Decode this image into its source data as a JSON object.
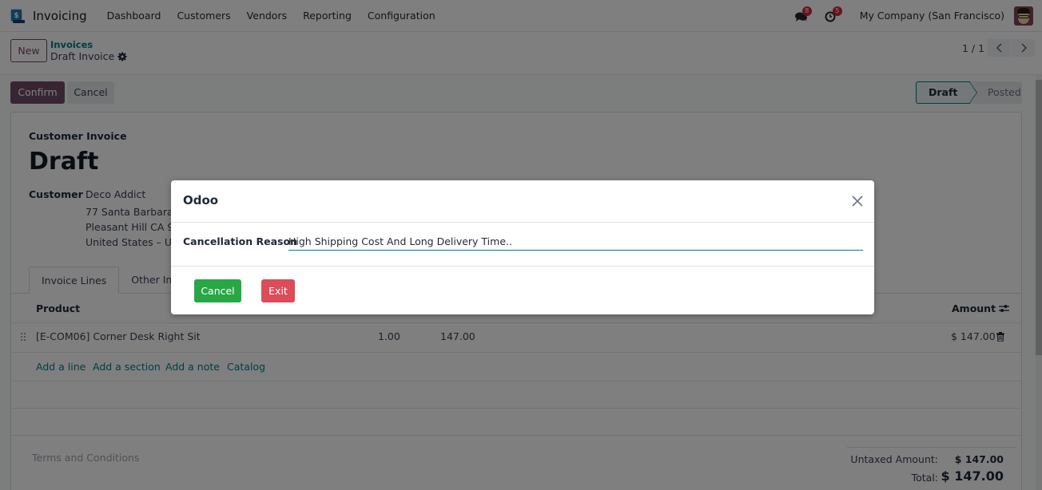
{
  "navbar": {
    "app_name": "Invoicing",
    "menu": [
      "Dashboard",
      "Customers",
      "Vendors",
      "Reporting",
      "Configuration"
    ],
    "messages_count": "8",
    "activities_count": "5",
    "company": "My Company (San Francisco)"
  },
  "control_panel": {
    "new_label": "New",
    "breadcrumb_parent": "Invoices",
    "breadcrumb_current": "Draft Invoice",
    "pager": "1 / 1"
  },
  "statusbar": {
    "confirm_label": "Confirm",
    "cancel_label": "Cancel",
    "stages": [
      "Draft",
      "Posted"
    ],
    "active_stage": "Draft"
  },
  "form": {
    "type": "Customer Invoice",
    "title": "Draft",
    "customer_label": "Customer",
    "customer_lines": [
      "Deco Addict",
      "77 Santa Barbara R",
      "Pleasant Hill CA 94",
      "United States – US"
    ],
    "tabs": [
      "Invoice Lines",
      "Other Info"
    ],
    "columns": {
      "product": "Product",
      "amount": "Amount"
    },
    "lines": [
      {
        "product": "[E-COM06] Corner Desk Right Sit",
        "quantity": "1.00",
        "price": "147.00",
        "amount": "$ 147.00"
      }
    ],
    "add_links": [
      "Add a line",
      "Add a section",
      "Add a note",
      "Catalog"
    ],
    "terms_placeholder": "Terms and Conditions",
    "totals": {
      "untaxed_label": "Untaxed Amount:",
      "untaxed_value": "$ 147.00",
      "total_label": "Total:",
      "total_value": "$ 147.00"
    }
  },
  "dialog": {
    "title": "Odoo",
    "field_label": "Cancellation Reason",
    "field_value": "High Shipping Cost And Long Delivery Time..",
    "cancel_label": "Cancel",
    "exit_label": "Exit"
  },
  "colors": {
    "brand": "#714b67",
    "accent": "#017e84",
    "success": "#28a745",
    "danger": "#dc4c5a"
  }
}
